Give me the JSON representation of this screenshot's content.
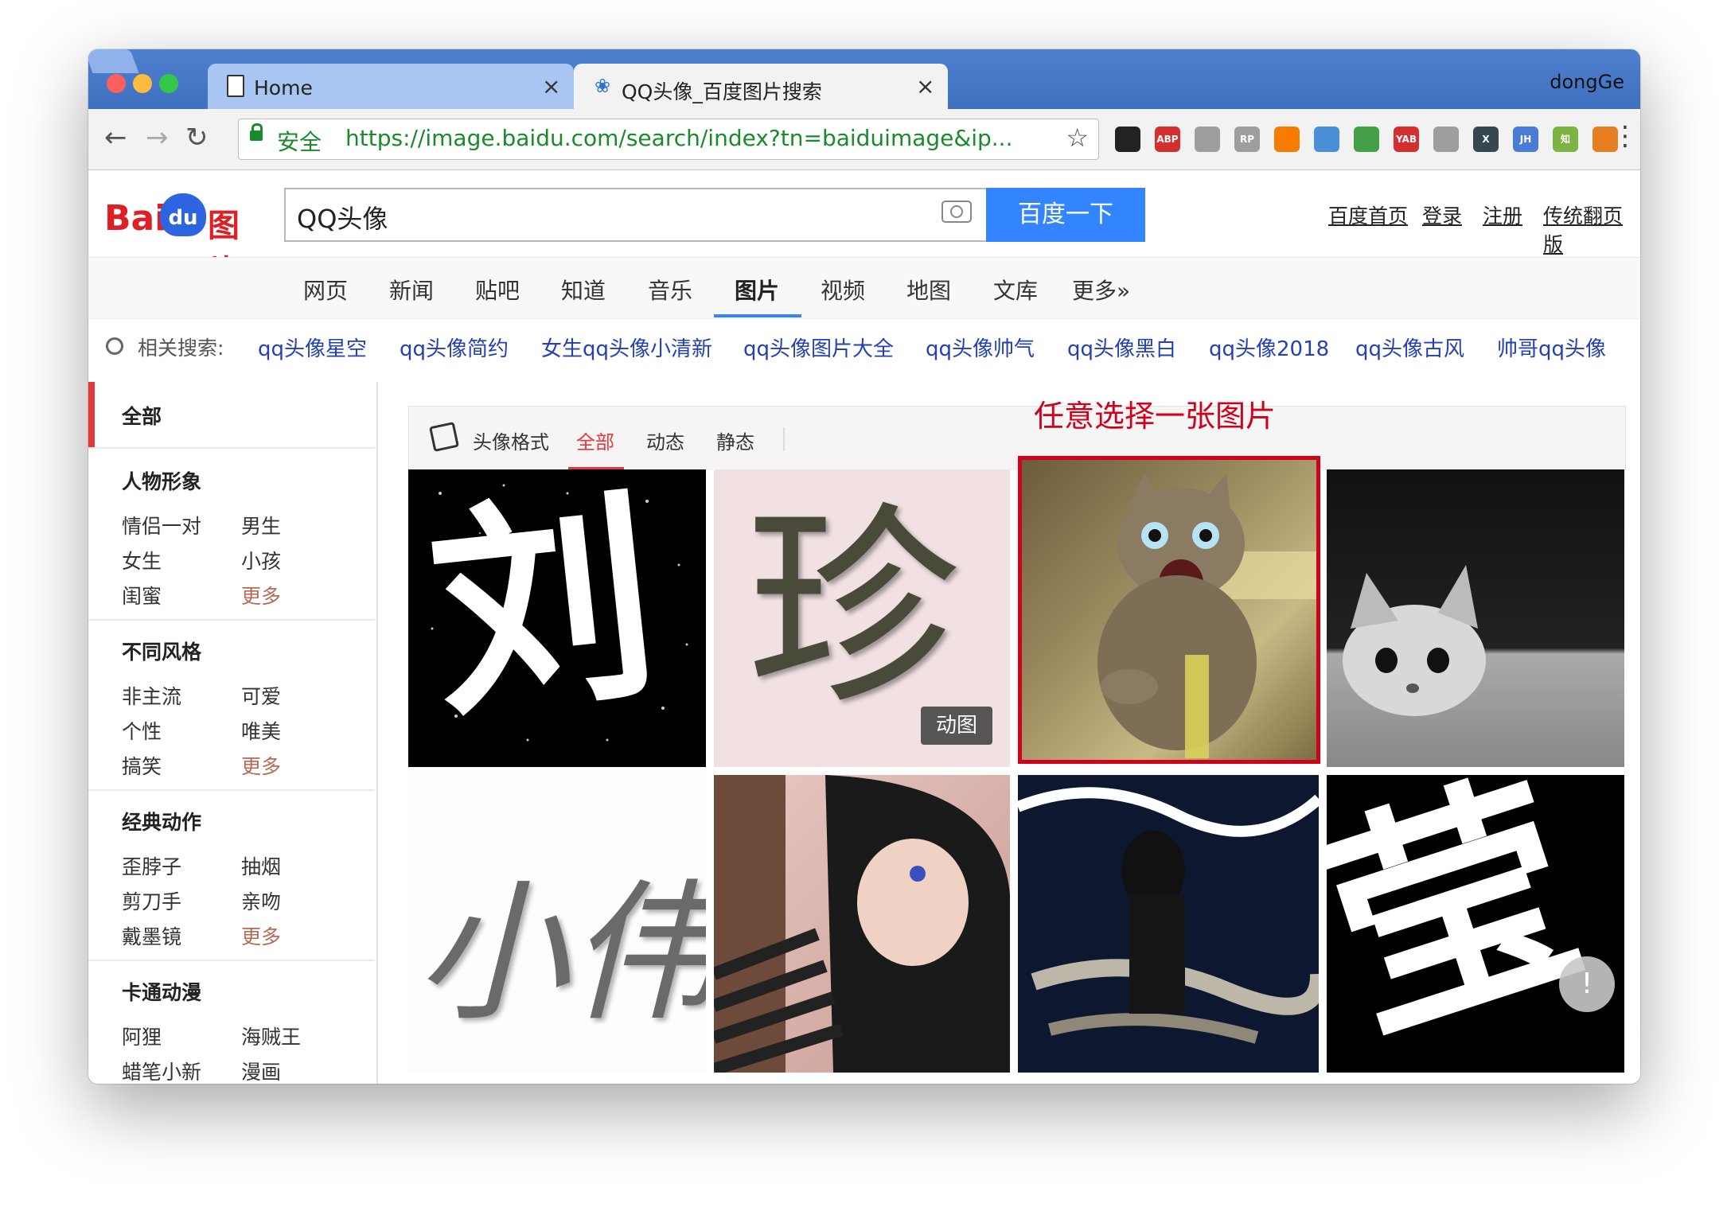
{
  "browser": {
    "user": "dongGe",
    "tabs": [
      {
        "title": "Home"
      },
      {
        "title": "QQ头像_百度图片搜索"
      }
    ],
    "address": {
      "secure_label": "安全",
      "url": "https://image.baidu.com/search/index?tn=baiduimage&ip..."
    },
    "extensions": [
      {
        "name": "qr-code",
        "label": "",
        "color": "#222222"
      },
      {
        "name": "adblock",
        "label": "ABP",
        "color": "#d32f2f"
      },
      {
        "name": "globe",
        "label": "",
        "color": "#9e9e9e"
      },
      {
        "name": "rp",
        "label": "RP",
        "color": "#9e9e9e"
      },
      {
        "name": "orange-ring",
        "label": "",
        "color": "#f57c00"
      },
      {
        "name": "translate",
        "label": "",
        "color": "#4a90d9"
      },
      {
        "name": "shield",
        "label": "",
        "color": "#43a047"
      },
      {
        "name": "yab",
        "label": "YAB",
        "color": "#d32f2f"
      },
      {
        "name": "gray-globe",
        "label": "",
        "color": "#9e9e9e"
      },
      {
        "name": "x-ext",
        "label": "X",
        "color": "#37474f"
      },
      {
        "name": "jh",
        "label": "JH",
        "color": "#4a7bd8"
      },
      {
        "name": "zhi",
        "label": "知",
        "color": "#7cb342"
      },
      {
        "name": "fox",
        "label": "",
        "color": "#e67e22"
      }
    ]
  },
  "baidu": {
    "logo": {
      "bai": "Bai",
      "du": "du",
      "pic": "图片"
    },
    "query": "QQ头像",
    "search_button": "百度一下",
    "top_links": [
      "百度首页",
      "登录",
      "注册",
      "传统翻页版"
    ],
    "nav": [
      "网页",
      "新闻",
      "贴吧",
      "知道",
      "音乐",
      "图片",
      "视频",
      "地图",
      "文库",
      "更多»"
    ],
    "related_label": "相关搜索:",
    "related": [
      "qq头像星空",
      "qq头像简约",
      "女生qq头像小清新",
      "qq头像图片大全",
      "qq头像帅气",
      "qq头像黑白",
      "qq头像2018",
      "qq头像古风",
      "帅哥qq头像"
    ]
  },
  "sidebar": {
    "all": "全部",
    "sections": [
      {
        "title": "人物形象",
        "items": [
          "情侣一对",
          "男生",
          "女生",
          "小孩",
          "闺蜜"
        ],
        "more": "更多"
      },
      {
        "title": "不同风格",
        "items": [
          "非主流",
          "可爱",
          "个性",
          "唯美",
          "搞笑"
        ],
        "more": "更多"
      },
      {
        "title": "经典动作",
        "items": [
          "歪脖子",
          "抽烟",
          "剪刀手",
          "亲吻",
          "戴墨镜"
        ],
        "more": "更多"
      },
      {
        "title": "卡通动漫",
        "items": [
          "阿狸",
          "海贼王",
          "蜡笔小新",
          "漫画"
        ],
        "more": ""
      }
    ]
  },
  "filter": {
    "label": "头像格式",
    "options": [
      "全部",
      "动态",
      "静态"
    ],
    "active": "全部"
  },
  "annotation": "任意选择一张图片",
  "thumbs": {
    "liu": "刘",
    "zhen": "珍",
    "zhen_badge": "动图",
    "xiaowei": "小伟",
    "ying": "莹"
  },
  "scroll_hint": "!"
}
